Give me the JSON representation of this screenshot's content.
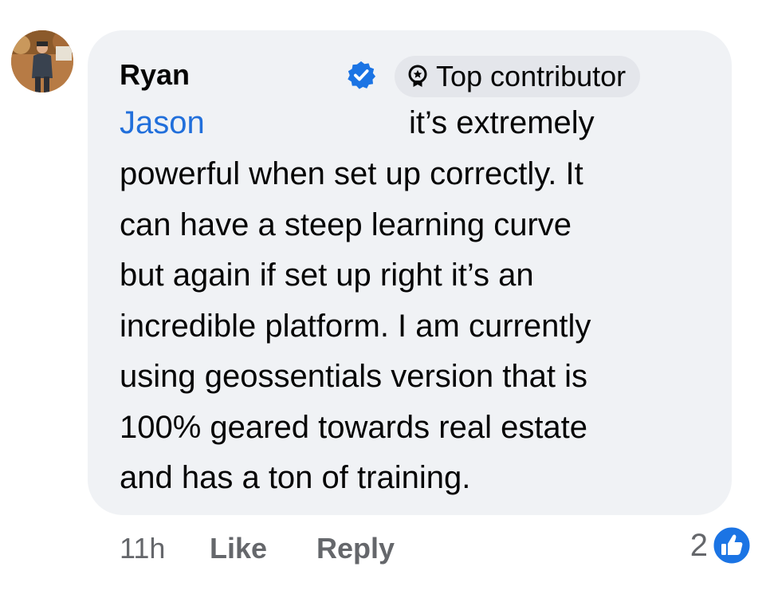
{
  "comment": {
    "author": "Ryan",
    "badge_label": "Top contributor",
    "mention": "Jason",
    "lines": [
      "it’s extremely",
      "powerful when set up correctly. It",
      "can have a steep learning curve",
      "but again if set up right it’s an",
      "incredible platform. I am currently",
      "using geossentials version that is",
      "100% geared towards real estate",
      "and has a ton of training."
    ],
    "icons": {
      "avatar": "avatar-photo",
      "verified": "verified-badge-icon",
      "badge": "top-contributor-icon",
      "reaction": "like-reaction-icon"
    },
    "accent_color": "#216fdb",
    "verified_color": "#1b74e4"
  },
  "footer": {
    "time": "11h",
    "like_label": "Like",
    "reply_label": "Reply",
    "reaction_count": "2"
  }
}
